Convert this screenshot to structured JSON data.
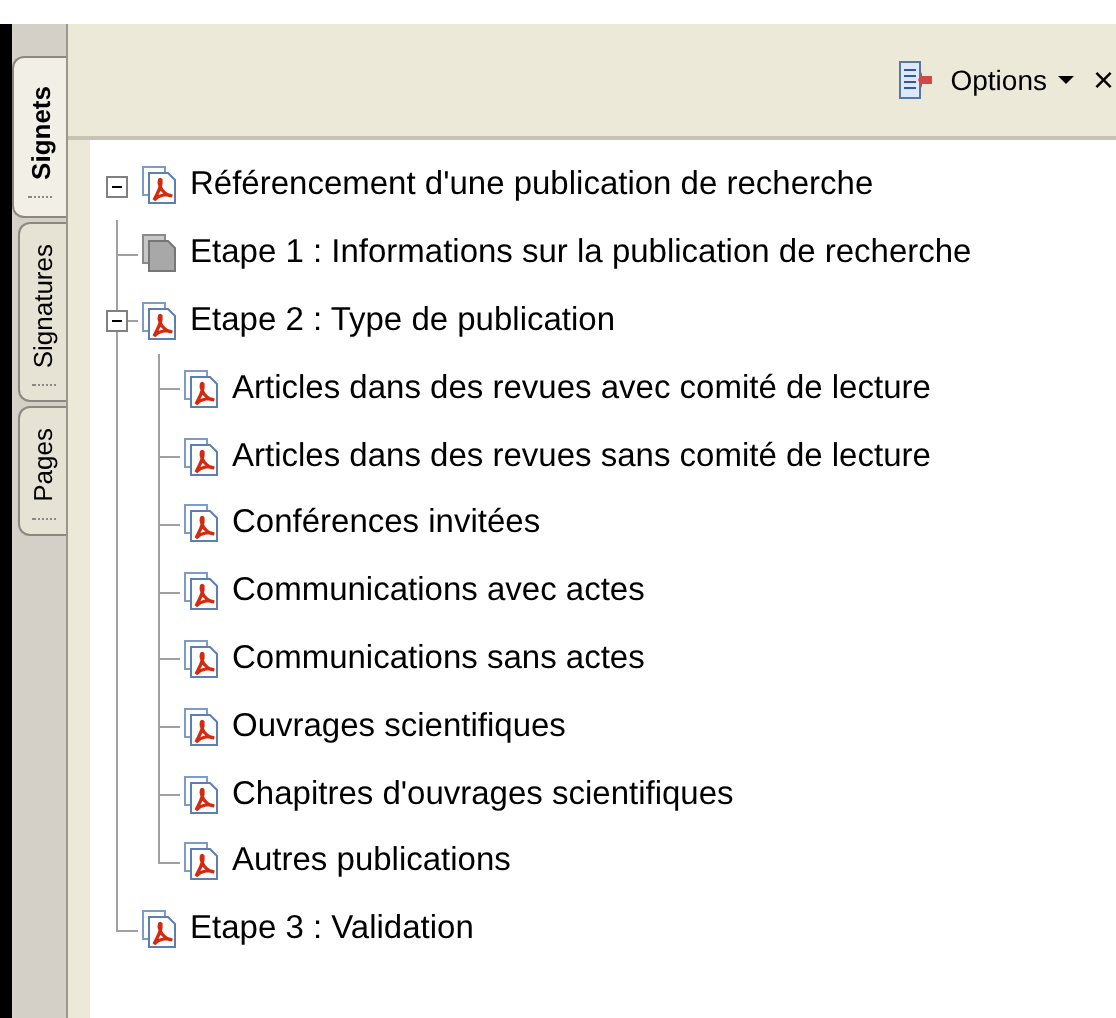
{
  "side_tabs": [
    {
      "label": "Signets",
      "selected": true
    },
    {
      "label": "Signatures",
      "selected": false
    },
    {
      "label": "Pages",
      "selected": false
    }
  ],
  "toolbar": {
    "options_label": "Options",
    "close": "×"
  },
  "bookmarks": [
    {
      "label": "Référencement d'une publication de recherche",
      "kind": "pdf",
      "expanded": true,
      "children": [
        {
          "label": "Etape 1 : Informations sur la publication de recherche",
          "kind": "blank"
        },
        {
          "label": "Etape 2 : Type de publication",
          "kind": "pdf",
          "expanded": true,
          "children": [
            {
              "label": "Articles dans des revues avec comité de lecture",
              "kind": "pdf"
            },
            {
              "label": "Articles dans des revues sans comité de lecture",
              "kind": "pdf"
            },
            {
              "label": "Conférences invitées",
              "kind": "pdf"
            },
            {
              "label": "Communications avec actes",
              "kind": "pdf"
            },
            {
              "label": "Communications sans actes",
              "kind": "pdf"
            },
            {
              "label": "Ouvrages scientifiques",
              "kind": "pdf"
            },
            {
              "label": "Chapitres d'ouvrages scientifiques",
              "kind": "pdf"
            },
            {
              "label": "Autres publications",
              "kind": "pdf"
            }
          ]
        },
        {
          "label": "Etape 3 : Validation",
          "kind": "pdf"
        }
      ]
    }
  ]
}
